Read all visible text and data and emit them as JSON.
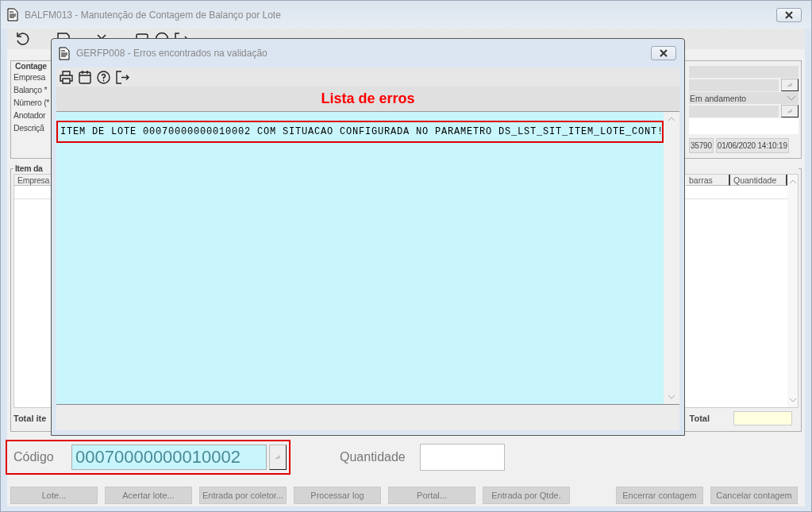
{
  "window": {
    "title": "BALFM013 - Manutenção de Contagem de Balanço por Lote"
  },
  "header_group": {
    "title": "Contage",
    "labels": [
      "Empresa",
      "Balanço *",
      "Número (*",
      "Anotador",
      "Descriçã"
    ],
    "situacao": "Em andamento",
    "number": "35790",
    "date": "01/06/2020 14:10:19"
  },
  "items_group": {
    "title": "Item da",
    "columns": [
      "Empresa",
      "barras",
      "Quantidade"
    ],
    "total_label": "Total ite",
    "total_right": "Total"
  },
  "codigo": {
    "label": "Código",
    "value": "00070000000010002",
    "highlighted": true
  },
  "quantidade": {
    "label": "Quantidade"
  },
  "buttons": [
    {
      "label": "Lote...",
      "disabled": true
    },
    {
      "label": "Acertar lote...",
      "disabled": true
    },
    {
      "label": "Entrada por coletor...",
      "disabled": true
    },
    {
      "label": "Processar log",
      "disabled": true
    },
    {
      "label": "Portal...",
      "disabled": true
    },
    {
      "label": "Entrada por Qtde.",
      "disabled": true
    },
    {
      "label": "Encerrar contagem",
      "disabled": true
    },
    {
      "label": "Cancelar contagem",
      "disabled": true
    }
  ],
  "dialog": {
    "title": "GERFP008 - Erros encontrados na validação",
    "heading": "Lista de erros",
    "errors": [
      {
        "text": "ITEM DE LOTE 00070000000010002 COM SITUACAO CONFIGURADA NO PARAMETRO DS_LST_SIT_ITEM_LOTE_CONT!",
        "selected": true
      }
    ]
  }
}
